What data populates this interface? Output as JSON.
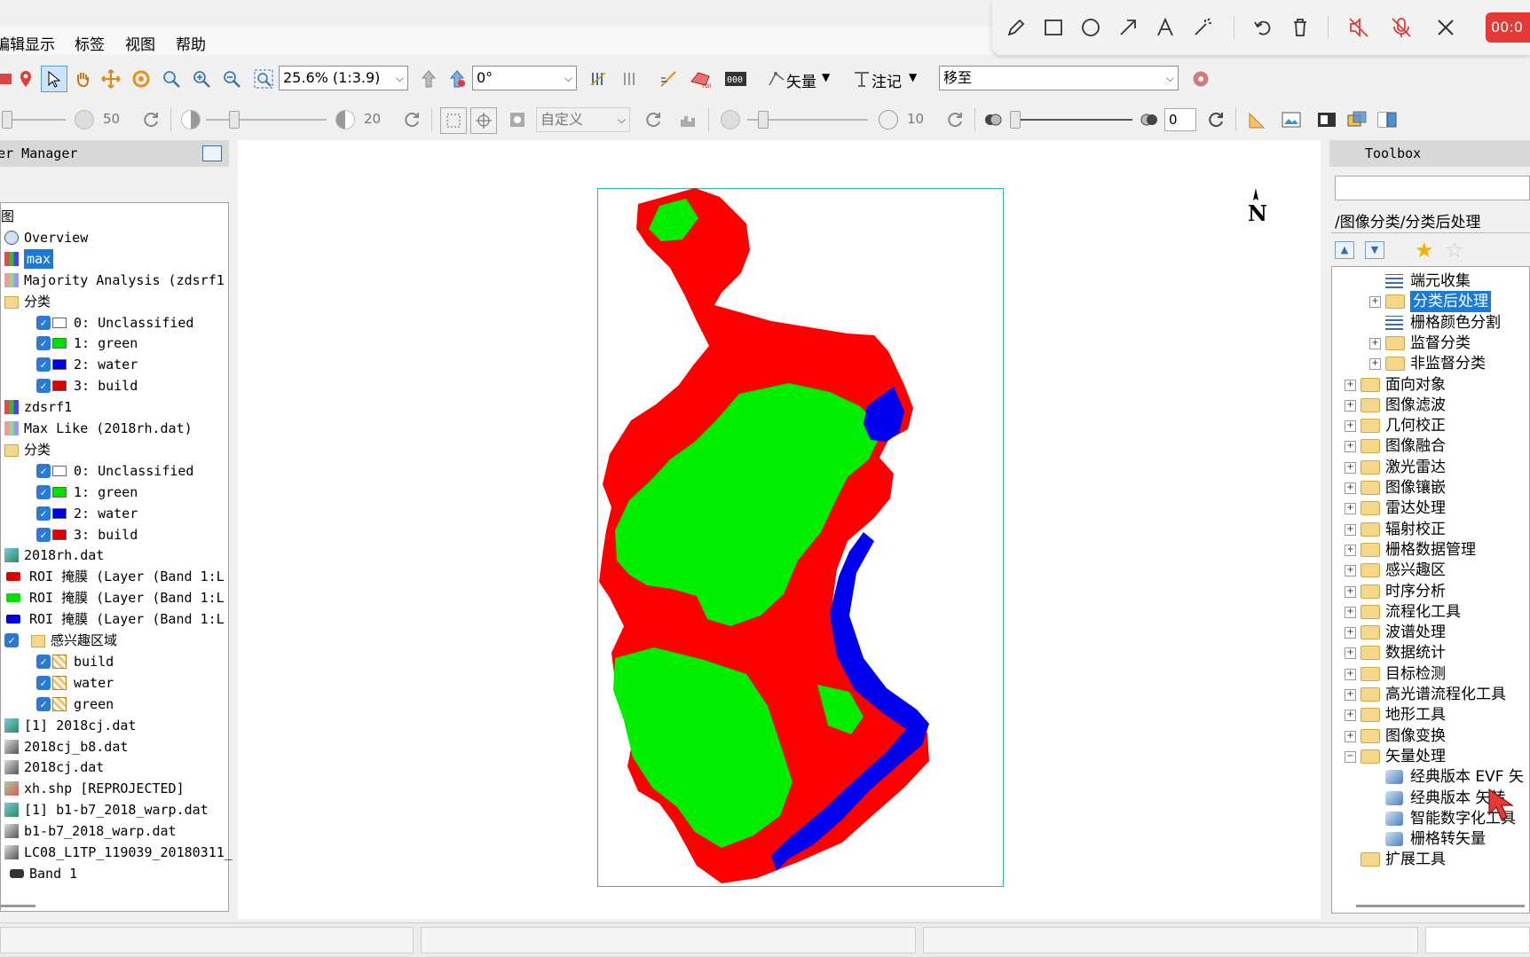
{
  "menu": {
    "items": [
      "编辑",
      "显示",
      "标签",
      "视图",
      "帮助"
    ]
  },
  "recorder": {
    "timer": "00:0"
  },
  "toolbar1": {
    "zoom_value": "25.6% (1:3.9)",
    "rotation_value": "0°",
    "vector_label": "矢量",
    "annotation_label": "注记",
    "goto_value": "移至"
  },
  "toolbar2": {
    "brightness_value": "50",
    "contrast_value": "20",
    "stretch_value": "自定义",
    "sharpen_value": "10",
    "transparency_value": "0"
  },
  "layer_manager": {
    "title": "Layer Manager",
    "root_label": "图",
    "items": [
      {
        "label": "Overview"
      },
      {
        "label": "max",
        "selected": true
      },
      {
        "label": "Majority Analysis (zdsrf1"
      },
      {
        "label": "分类"
      },
      {
        "label": "0: Unclassified",
        "color": "#ffffff"
      },
      {
        "label": "1: green",
        "color": "#00e000"
      },
      {
        "label": "2: water",
        "color": "#0000e0"
      },
      {
        "label": "3: build",
        "color": "#e00000"
      },
      {
        "label": "zdsrf1"
      },
      {
        "label": "Max Like (2018rh.dat)"
      },
      {
        "label": "分类"
      },
      {
        "label": "0: Unclassified",
        "color": "#ffffff"
      },
      {
        "label": "1: green",
        "color": "#00e000"
      },
      {
        "label": "2: water",
        "color": "#0000e0"
      },
      {
        "label": "3: build",
        "color": "#e00000"
      },
      {
        "label": "2018rh.dat"
      },
      {
        "label": "ROI 掩膜 (Layer (Band 1:L",
        "color": "#e00000"
      },
      {
        "label": "ROI 掩膜 (Layer (Band 1:L",
        "color": "#00e000"
      },
      {
        "label": "ROI 掩膜 (Layer (Band 1:L",
        "color": "#0000e0"
      },
      {
        "label": "感兴趣区域"
      },
      {
        "label": "build"
      },
      {
        "label": "water"
      },
      {
        "label": "green"
      },
      {
        "label": "[1] 2018cj.dat"
      },
      {
        "label": "2018cj_b8.dat"
      },
      {
        "label": "2018cj.dat"
      },
      {
        "label": "xh.shp [REPROJECTED]"
      },
      {
        "label": "[1] b1-b7_2018_warp.dat"
      },
      {
        "label": "b1-b7_2018_warp.dat"
      },
      {
        "label": "LC08_L1TP_119039_20180311_"
      },
      {
        "label": "Band 1"
      }
    ]
  },
  "view": {
    "north_label": "N",
    "legend_colors": {
      "green": "#00ee00",
      "water": "#0000f0",
      "build": "#ff0000"
    }
  },
  "toolbox": {
    "title": "Toolbox",
    "path": "/图像分类/分类后处理",
    "items": [
      {
        "label": "端元收集",
        "level": 2,
        "type": "tool"
      },
      {
        "label": "分类后处理",
        "level": 2,
        "type": "folder",
        "selected": true
      },
      {
        "label": "栅格颜色分割",
        "level": 2,
        "type": "tool"
      },
      {
        "label": "监督分类",
        "level": 2,
        "type": "folder"
      },
      {
        "label": "非监督分类",
        "level": 2,
        "type": "folder"
      },
      {
        "label": "面向对象",
        "level": 1,
        "type": "folder"
      },
      {
        "label": "图像滤波",
        "level": 1,
        "type": "folder"
      },
      {
        "label": "几何校正",
        "level": 1,
        "type": "folder"
      },
      {
        "label": "图像融合",
        "level": 1,
        "type": "folder"
      },
      {
        "label": "激光雷达",
        "level": 1,
        "type": "folder"
      },
      {
        "label": "图像镶嵌",
        "level": 1,
        "type": "folder"
      },
      {
        "label": "雷达处理",
        "level": 1,
        "type": "folder"
      },
      {
        "label": "辐射校正",
        "level": 1,
        "type": "folder"
      },
      {
        "label": "栅格数据管理",
        "level": 1,
        "type": "folder"
      },
      {
        "label": "感兴趣区",
        "level": 1,
        "type": "folder"
      },
      {
        "label": "时序分析",
        "level": 1,
        "type": "folder"
      },
      {
        "label": "流程化工具",
        "level": 1,
        "type": "folder"
      },
      {
        "label": "波谱处理",
        "level": 1,
        "type": "folder"
      },
      {
        "label": "数据统计",
        "level": 1,
        "type": "folder"
      },
      {
        "label": "目标检测",
        "level": 1,
        "type": "folder"
      },
      {
        "label": "高光谱流程化工具",
        "level": 1,
        "type": "folder"
      },
      {
        "label": "地形工具",
        "level": 1,
        "type": "folder"
      },
      {
        "label": "图像变换",
        "level": 1,
        "type": "folder"
      },
      {
        "label": "矢量处理",
        "level": 1,
        "type": "folder",
        "expanded": true
      },
      {
        "label": "经典版本 EVF 矢",
        "level": 2,
        "type": "tool"
      },
      {
        "label": "经典版本 矢转",
        "level": 2,
        "type": "tool"
      },
      {
        "label": "智能数字化工具",
        "level": 2,
        "type": "tool"
      },
      {
        "label": "栅格转矢量",
        "level": 2,
        "type": "tool"
      },
      {
        "label": "扩展工具",
        "level": 1,
        "type": "folder"
      }
    ]
  }
}
